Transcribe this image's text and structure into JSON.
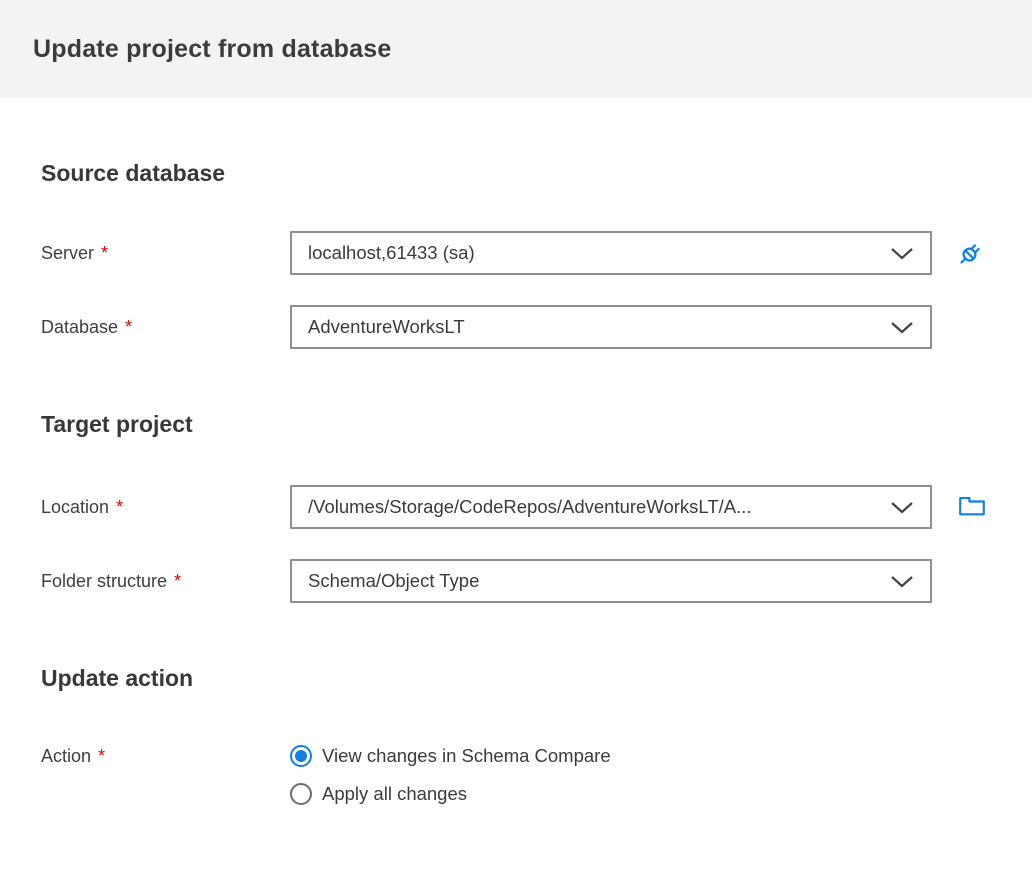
{
  "colors": {
    "accent_blue": "#0f80e0",
    "required_red": "#e40000",
    "header_background": "#f3f3f3",
    "field_border_gray": "#8f8f8f",
    "text_gray": "#3c3c3c"
  },
  "header": {
    "title": "Update project from database"
  },
  "form": {
    "source_database": {
      "title": "Source database",
      "server": {
        "label": "Server",
        "required_mark": "*",
        "value": "localhost,61433 (sa)",
        "trailing_icon": "connect-plug-icon"
      },
      "database": {
        "label": "Database",
        "required_mark": "*",
        "value": "AdventureWorksLT"
      }
    },
    "target_project": {
      "title": "Target project",
      "location": {
        "label": "Location",
        "required_mark": "*",
        "value": "/Volumes/Storage/CodeRepos/AdventureWorksLT/A...",
        "trailing_icon": "folder-icon"
      },
      "folder_structure": {
        "label": "Folder structure",
        "required_mark": "*",
        "value": "Schema/Object Type"
      }
    },
    "update_action": {
      "title": "Update action",
      "action": {
        "label": "Action",
        "required_mark": "*",
        "options": [
          {
            "label": "View changes in Schema Compare",
            "selected": true
          },
          {
            "label": "Apply all changes",
            "selected": false
          }
        ]
      }
    }
  }
}
